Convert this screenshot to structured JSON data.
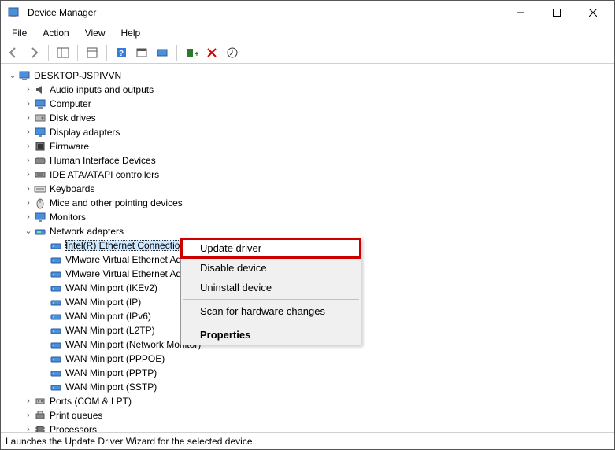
{
  "window": {
    "title": "Device Manager"
  },
  "menubar": {
    "items": [
      "File",
      "Action",
      "View",
      "Help"
    ]
  },
  "toolbar": {
    "buttons": [
      "back",
      "forward",
      "sep",
      "show-hide-console",
      "sep",
      "properties",
      "sep",
      "help",
      "sep2",
      "scan",
      "sep3",
      "add-legacy",
      "uninstall",
      "enable"
    ]
  },
  "tree": {
    "root": {
      "label": "DESKTOP-JSPIVVN",
      "expanded": true
    },
    "categories": [
      {
        "label": "Audio inputs and outputs",
        "icon": "audio-icon",
        "expanded": false
      },
      {
        "label": "Computer",
        "icon": "computer-icon",
        "expanded": false
      },
      {
        "label": "Disk drives",
        "icon": "disk-icon",
        "expanded": false
      },
      {
        "label": "Display adapters",
        "icon": "display-icon",
        "expanded": false
      },
      {
        "label": "Firmware",
        "icon": "firmware-icon",
        "expanded": false
      },
      {
        "label": "Human Interface Devices",
        "icon": "hid-icon",
        "expanded": false
      },
      {
        "label": "IDE ATA/ATAPI controllers",
        "icon": "ide-icon",
        "expanded": false
      },
      {
        "label": "Keyboards",
        "icon": "keyboard-icon",
        "expanded": false
      },
      {
        "label": "Mice and other pointing devices",
        "icon": "mouse-icon",
        "expanded": false
      },
      {
        "label": "Monitors",
        "icon": "monitor-icon",
        "expanded": false
      },
      {
        "label": "Network adapters",
        "icon": "network-icon",
        "expanded": true,
        "children": [
          {
            "label": "Intel(R) Ethernet Connection",
            "selected": true
          },
          {
            "label": "VMware Virtual Ethernet Ad"
          },
          {
            "label": "VMware Virtual Ethernet Ad"
          },
          {
            "label": "WAN Miniport (IKEv2)"
          },
          {
            "label": "WAN Miniport (IP)"
          },
          {
            "label": "WAN Miniport (IPv6)"
          },
          {
            "label": "WAN Miniport (L2TP)"
          },
          {
            "label": "WAN Miniport (Network Monitor)"
          },
          {
            "label": "WAN Miniport (PPPOE)"
          },
          {
            "label": "WAN Miniport (PPTP)"
          },
          {
            "label": "WAN Miniport (SSTP)"
          }
        ]
      },
      {
        "label": "Ports (COM & LPT)",
        "icon": "port-icon",
        "expanded": false
      },
      {
        "label": "Print queues",
        "icon": "printer-icon",
        "expanded": false
      },
      {
        "label": "Processors",
        "icon": "cpu-icon",
        "expanded": false
      }
    ]
  },
  "context_menu": {
    "items": [
      {
        "label": "Update driver",
        "highlighted": true
      },
      {
        "label": "Disable device"
      },
      {
        "label": "Uninstall device"
      },
      {
        "sep": true
      },
      {
        "label": "Scan for hardware changes"
      },
      {
        "sep": true
      },
      {
        "label": "Properties",
        "bold": true
      }
    ]
  },
  "statusbar": {
    "text": "Launches the Update Driver Wizard for the selected device."
  }
}
